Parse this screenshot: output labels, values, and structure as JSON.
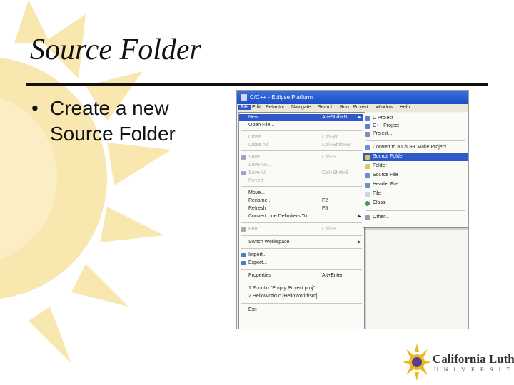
{
  "slide": {
    "title": "Source Folder",
    "bullet_marker": "•",
    "bullet": "Create a new Source Folder"
  },
  "colors": {
    "accent_sun": "#f7d98a",
    "menu_highlight": "#2f58c8",
    "title_bar": "#2a5fd8"
  },
  "window": {
    "title": "C/C++ - Eclipse Platform",
    "menubar": [
      "File",
      "Edit",
      "Refactor",
      "Navigate",
      "Search",
      "Run",
      "Project",
      "Window",
      "Help"
    ]
  },
  "file_menu": {
    "items": [
      {
        "label": "New",
        "shortcut": "Alt+Shift+N",
        "submenu": true,
        "highlighted": true,
        "icon": ""
      },
      {
        "label": "Open File...",
        "shortcut": "",
        "icon": ""
      },
      {
        "label": "Close",
        "shortcut": "Ctrl+W",
        "disabled": true,
        "icon": ""
      },
      {
        "label": "Close All",
        "shortcut": "Ctrl+Shift+W",
        "disabled": true,
        "icon": ""
      },
      {
        "label": "Save",
        "shortcut": "Ctrl+S",
        "disabled": true,
        "icon": "save-icon"
      },
      {
        "label": "Save As...",
        "shortcut": "",
        "disabled": true,
        "icon": ""
      },
      {
        "label": "Save All",
        "shortcut": "Ctrl+Shift+S",
        "disabled": true,
        "icon": "save-all-icon"
      },
      {
        "label": "Revert",
        "shortcut": "",
        "disabled": true,
        "icon": ""
      },
      {
        "label": "Move...",
        "shortcut": "",
        "icon": ""
      },
      {
        "label": "Rename...",
        "shortcut": "F2",
        "icon": ""
      },
      {
        "label": "Refresh",
        "shortcut": "F5",
        "icon": ""
      },
      {
        "label": "Convert Line Delimiters To",
        "shortcut": "",
        "submenu": true,
        "icon": ""
      },
      {
        "label": "Print...",
        "shortcut": "Ctrl+P",
        "disabled": true,
        "icon": "print-icon"
      },
      {
        "label": "Switch Workspace",
        "shortcut": "",
        "submenu": true,
        "icon": ""
      },
      {
        "label": "Import...",
        "shortcut": "",
        "icon": "import-icon"
      },
      {
        "label": "Export...",
        "shortcut": "",
        "icon": "export-icon"
      },
      {
        "label": "Properties",
        "shortcut": "Alt+Enter",
        "icon": ""
      },
      {
        "label": "1 Functio \"Empty Project.proj\"",
        "shortcut": "",
        "icon": ""
      },
      {
        "label": "2 HelloWorld.c [HelloWorld/src]",
        "shortcut": "",
        "icon": ""
      },
      {
        "label": "Exit",
        "shortcut": "",
        "icon": ""
      }
    ]
  },
  "new_submenu": {
    "items": [
      {
        "label": "C Project",
        "icon": "c-project-icon"
      },
      {
        "label": "C++ Project",
        "icon": "cpp-project-icon"
      },
      {
        "label": "Project...",
        "icon": "project-icon"
      },
      {
        "label": "Convert to a C/C++ Make Project",
        "icon": "convert-icon"
      },
      {
        "label": "Source Folder",
        "icon": "source-folder-icon",
        "highlighted": true
      },
      {
        "label": "Folder",
        "icon": "folder-icon"
      },
      {
        "label": "Source File",
        "icon": "source-file-icon"
      },
      {
        "label": "Header File",
        "icon": "header-file-icon"
      },
      {
        "label": "File",
        "icon": "file-icon"
      },
      {
        "label": "Class",
        "icon": "class-icon"
      },
      {
        "label": "Other...",
        "icon": "other-icon"
      }
    ]
  },
  "logo": {
    "name": "California Lutheran",
    "subtitle": "UNIVERSITY"
  }
}
